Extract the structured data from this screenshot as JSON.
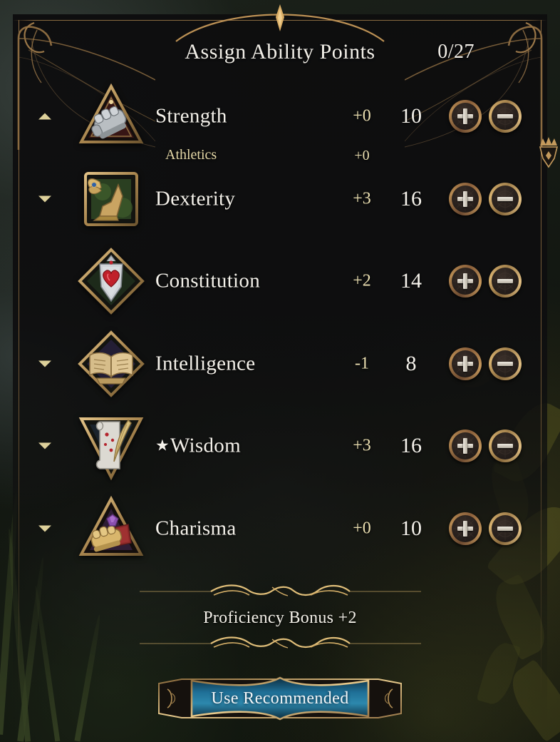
{
  "header": {
    "title": "Assign Ability Points",
    "points_remaining": "0/27"
  },
  "abilities": [
    {
      "name": "Strength",
      "modifier": "+0",
      "score": "10",
      "icon": "strength-gauntlet-icon",
      "expanded": true,
      "caret": "up",
      "primary": false,
      "star": "",
      "skills": [
        {
          "name": "Athletics",
          "modifier": "+0"
        }
      ]
    },
    {
      "name": "Dexterity",
      "modifier": "+3",
      "score": "16",
      "icon": "dexterity-winged-boot-icon",
      "expanded": false,
      "caret": "down",
      "primary": false,
      "star": "",
      "skills": []
    },
    {
      "name": "Constitution",
      "modifier": "+2",
      "score": "14",
      "icon": "constitution-heart-icon",
      "expanded": false,
      "caret": "none",
      "primary": false,
      "star": "",
      "skills": []
    },
    {
      "name": "Intelligence",
      "modifier": "-1",
      "score": "8",
      "icon": "intelligence-book-icon",
      "expanded": false,
      "caret": "down",
      "primary": false,
      "star": "",
      "skills": []
    },
    {
      "name": "Wisdom",
      "modifier": "+3",
      "score": "16",
      "icon": "wisdom-scroll-quill-icon",
      "expanded": false,
      "caret": "down",
      "primary": true,
      "star": "★",
      "skills": []
    },
    {
      "name": "Charisma",
      "modifier": "+0",
      "score": "10",
      "icon": "charisma-gauntlet-gem-icon",
      "expanded": false,
      "caret": "down",
      "primary": false,
      "star": "",
      "skills": []
    }
  ],
  "stepper": {
    "increase_label": "+",
    "decrease_label": "–"
  },
  "footer": {
    "proficiency_label": "Proficiency Bonus  +2",
    "use_recommended_label": "Use Recommended"
  },
  "colors": {
    "gold": "#c79a5e",
    "gold_bright": "#e2c085",
    "text_primary": "#f4f1ea",
    "text_gold": "#ece0b2",
    "panel_bg": "#0d0d0e",
    "button_teal": "#1c6f93"
  }
}
